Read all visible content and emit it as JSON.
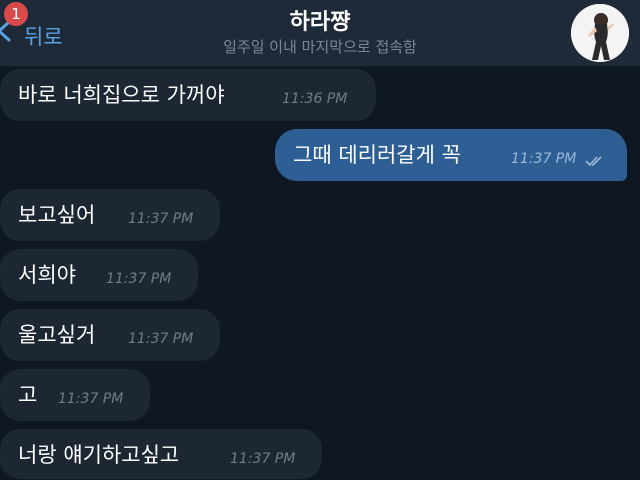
{
  "header": {
    "back_label": "뒤로",
    "badge_count": "1",
    "title": "하라쨩",
    "status": "일주일 이내 마지막으로 접속함"
  },
  "colors": {
    "header_bg": "#1e2a37",
    "chat_bg": "#0f1822",
    "incoming_bubble": "#1c2733",
    "outgoing_bubble": "#2d5f94",
    "accent": "#5aa2e6",
    "badge": "#d94b4b"
  },
  "messages": [
    {
      "text": "바로 너희집으로 가꺼야",
      "time": "11:36 PM",
      "direction": "in"
    },
    {
      "text": "그때 데리러갈게 꼭",
      "time": "11:37 PM",
      "direction": "out",
      "status_icon": "double-check-icon"
    },
    {
      "text": "보고싶어",
      "time": "11:37 PM",
      "direction": "in"
    },
    {
      "text": "서희야",
      "time": "11:37 PM",
      "direction": "in"
    },
    {
      "text": "울고싶거",
      "time": "11:37 PM",
      "direction": "in"
    },
    {
      "text": "고",
      "time": "11:37 PM",
      "direction": "in"
    },
    {
      "text": "너랑 얘기하고싶고",
      "time": "11:37 PM",
      "direction": "in"
    }
  ]
}
